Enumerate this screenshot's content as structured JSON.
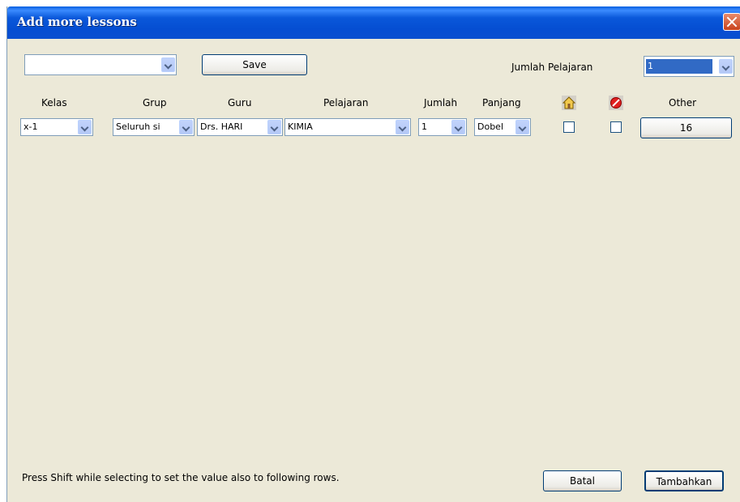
{
  "window": {
    "title": "Add more lessons"
  },
  "top": {
    "template_select_value": "",
    "save_label": "Save",
    "jumlah_pelajaran_label": "Jumlah Pelajaran",
    "jumlah_pelajaran_value": "1"
  },
  "headers": {
    "kelas": "Kelas",
    "grup": "Grup",
    "guru": "Guru",
    "pelajaran": "Pelajaran",
    "jumlah": "Jumlah",
    "panjang": "Panjang",
    "other": "Other"
  },
  "row": {
    "kelas": "x-1",
    "grup": "Seluruh si",
    "guru": "Drs. HARI",
    "pelajaran": "KIMIA",
    "jumlah": "1",
    "panjang": "Dobel",
    "home_checked": false,
    "blocked_checked": false,
    "other": "16"
  },
  "footer": {
    "hint": "Press Shift while selecting to set the value also to following rows.",
    "cancel_label": "Batal",
    "add_label": "Tambahkan"
  },
  "icons": {
    "home": "home-icon",
    "blocked": "no-entry-icon",
    "close": "close-icon"
  },
  "colors": {
    "titlebar": "#0A58DA",
    "dialog_bg": "#ECE9D8",
    "close_button": "#C9421C"
  }
}
